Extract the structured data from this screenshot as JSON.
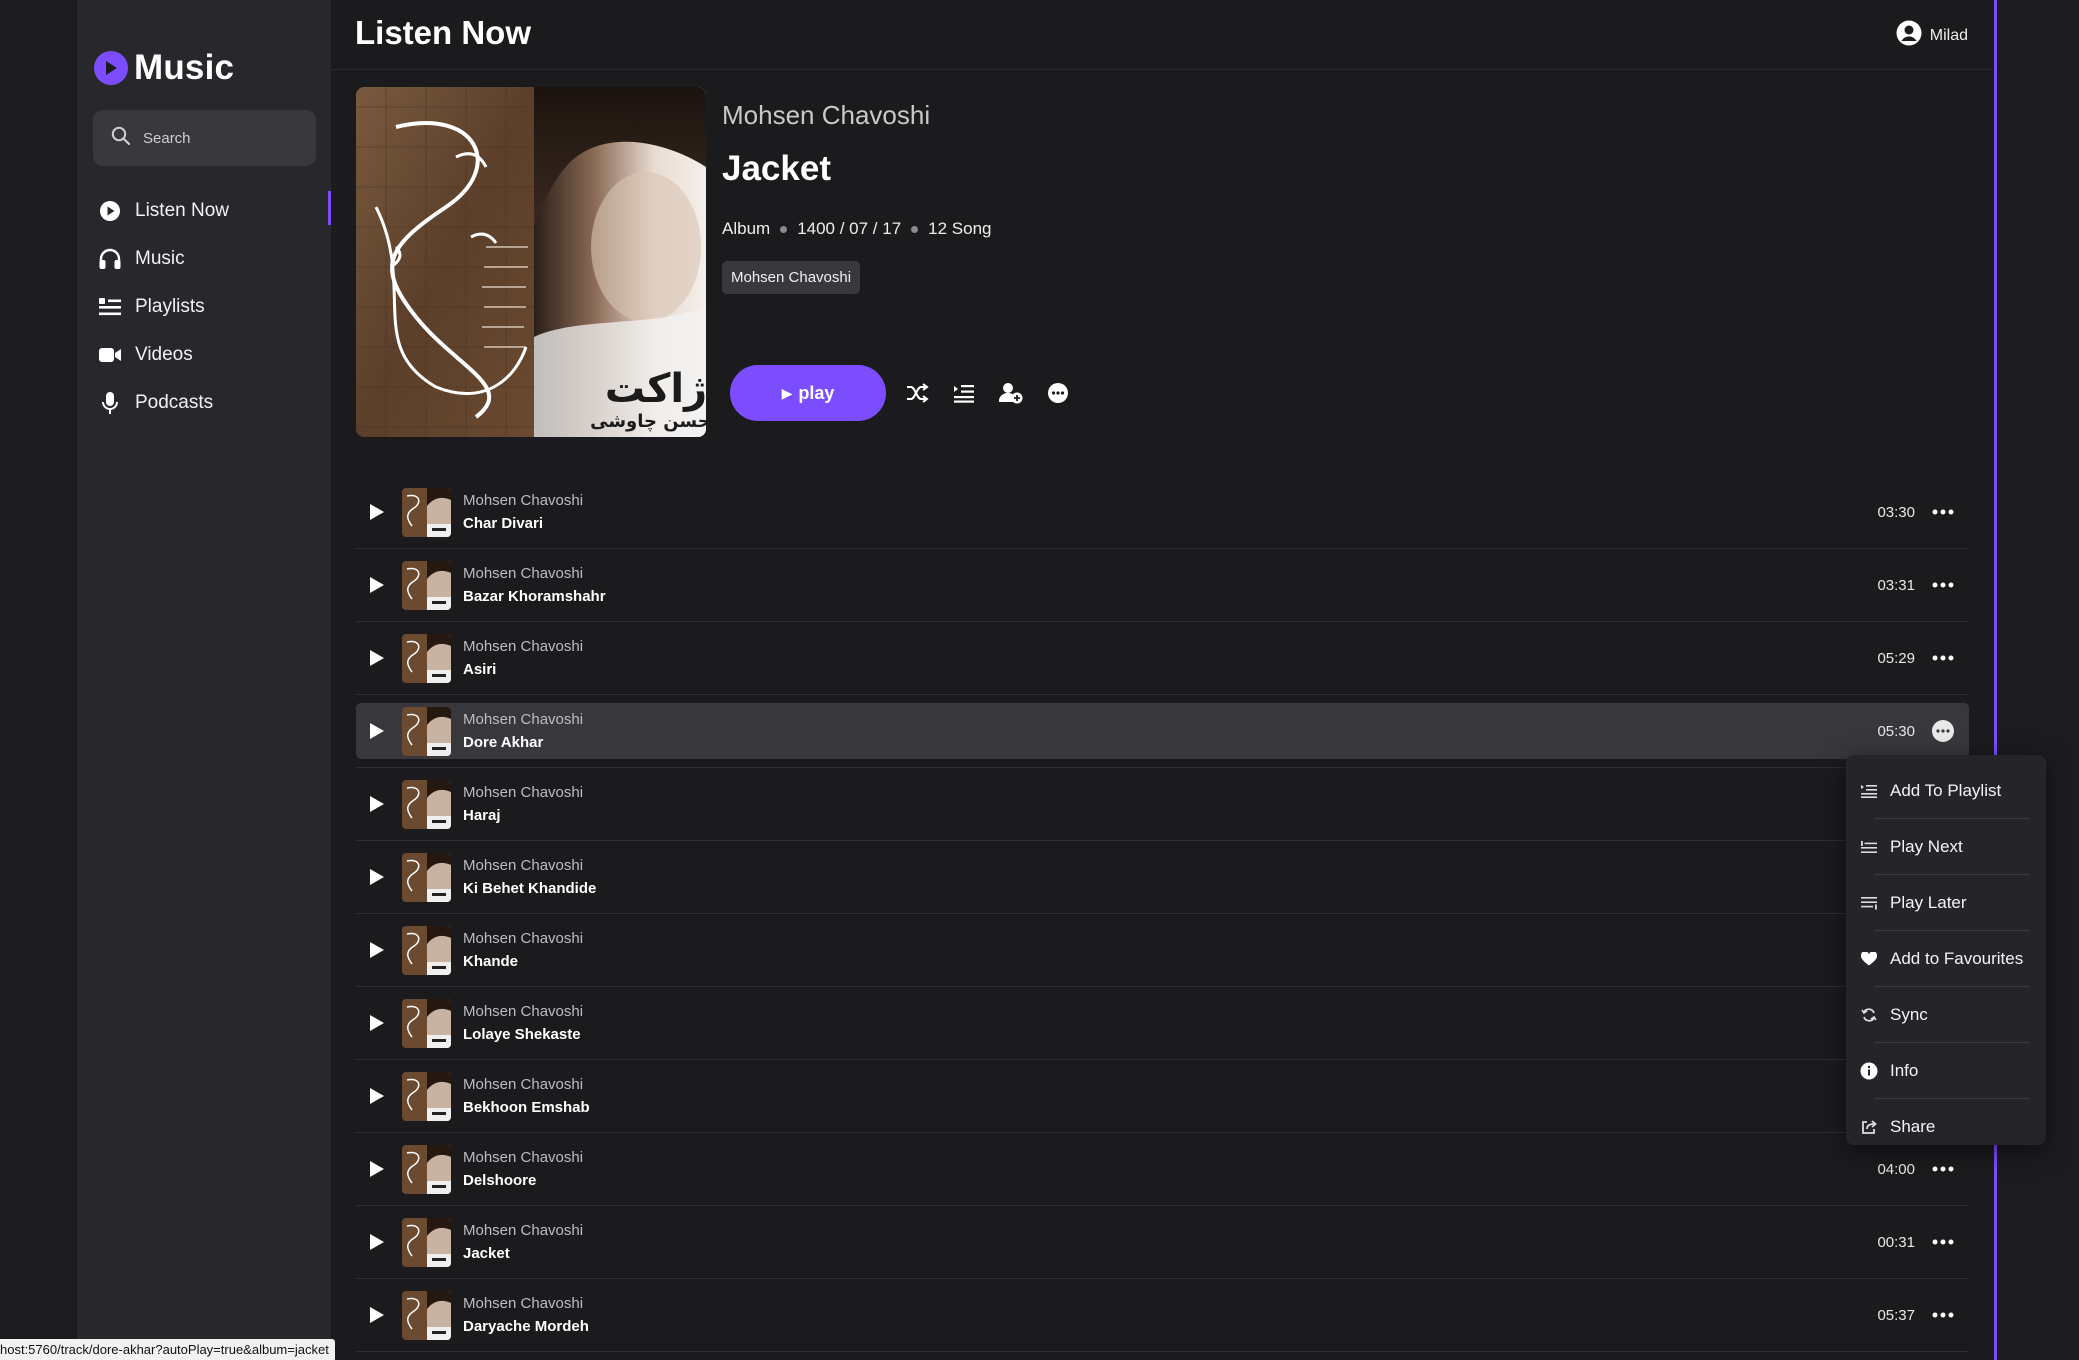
{
  "sidebar": {
    "brand": "Music",
    "search_placeholder": "Search",
    "items": [
      {
        "label": "Listen Now",
        "icon": "play-circle-icon"
      },
      {
        "label": "Music",
        "icon": "headphones-icon"
      },
      {
        "label": "Playlists",
        "icon": "playlist-icon"
      },
      {
        "label": "Videos",
        "icon": "video-camera-icon"
      },
      {
        "label": "Podcasts",
        "icon": "microphone-icon"
      }
    ],
    "active": "Listen Now"
  },
  "header": {
    "title": "Listen Now",
    "user": "Milad"
  },
  "album": {
    "artist": "Mohsen Chavoshi",
    "title": "Jacket",
    "type": "Album",
    "date": "1400 / 07 / 17",
    "count": "12 Song",
    "artist_chip": "Mohsen Chavoshi",
    "play_label": "play",
    "cover_text_title": "ژاکت",
    "cover_text_artist": "محسن چاوشی"
  },
  "tracks": [
    {
      "artist": "Mohsen Chavoshi",
      "title": "Char Divari",
      "duration": "03:30"
    },
    {
      "artist": "Mohsen Chavoshi",
      "title": "Bazar Khoramshahr",
      "duration": "03:31"
    },
    {
      "artist": "Mohsen Chavoshi",
      "title": "Asiri",
      "duration": "05:29"
    },
    {
      "artist": "Mohsen Chavoshi",
      "title": "Dore Akhar",
      "duration": "05:30"
    },
    {
      "artist": "Mohsen Chavoshi",
      "title": "Haraj",
      "duration": ""
    },
    {
      "artist": "Mohsen Chavoshi",
      "title": "Ki Behet Khandide",
      "duration": ""
    },
    {
      "artist": "Mohsen Chavoshi",
      "title": "Khande",
      "duration": ""
    },
    {
      "artist": "Mohsen Chavoshi",
      "title": "Lolaye Shekaste",
      "duration": ""
    },
    {
      "artist": "Mohsen Chavoshi",
      "title": "Bekhoon Emshab",
      "duration": ""
    },
    {
      "artist": "Mohsen Chavoshi",
      "title": "Delshoore",
      "duration": "04:00"
    },
    {
      "artist": "Mohsen Chavoshi",
      "title": "Jacket",
      "duration": "00:31"
    },
    {
      "artist": "Mohsen Chavoshi",
      "title": "Daryache Mordeh",
      "duration": "05:37"
    }
  ],
  "highlighted_track": "Dore Akhar",
  "context_menu": {
    "items": [
      {
        "label": "Add To Playlist",
        "icon": "add-to-playlist-icon"
      },
      {
        "label": "Play Next",
        "icon": "play-next-icon"
      },
      {
        "label": "Play Later",
        "icon": "play-later-icon"
      },
      {
        "label": "Add to Favourites",
        "icon": "heart-icon"
      },
      {
        "label": "Sync",
        "icon": "sync-icon"
      },
      {
        "label": "Info",
        "icon": "info-icon"
      },
      {
        "label": "Share",
        "icon": "share-icon"
      }
    ]
  },
  "status_url": "host:5760/track/dore-akhar?autoPlay=true&album=jacket",
  "colors": {
    "accent": "#7c4dff",
    "bg": "#1b1b1e",
    "sidebar": "#28282c"
  }
}
